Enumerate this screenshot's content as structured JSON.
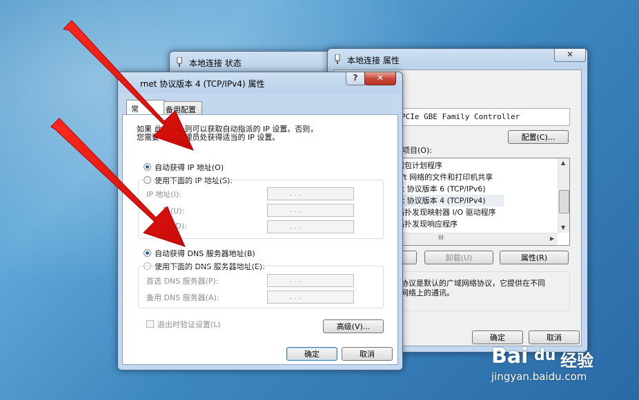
{
  "status_window": {
    "title": "本地连接 状态"
  },
  "properties_window": {
    "title": "本地连接 属性",
    "adapter_name": "PCIe GBE Family Controller",
    "configure_button": "配置(C)...",
    "items_label": "目项目(O):",
    "items": [
      "据包计划程序",
      "oft 网络的文件和打印机共享",
      "et 协议版本 6 (TCP/IPv6)",
      "et 协议版本 4 (TCP/IPv4)",
      "拓扑发现映射器 I/O 驱动程序",
      "拓扑发现响应程序"
    ],
    "hscroll_grip": "III",
    "uninstall_button": "卸载(U)",
    "properties_button": "属性(R)",
    "description": "协议是默认的广域网络协议，它提供在不同\n网络上的通讯。",
    "ok_button": "确定",
    "cancel_button": "取消"
  },
  "ipv4_dialog": {
    "title": "rnet 协议版本 4 (TCP/IPv4) 属性",
    "help_button": "?",
    "close_button": "✕",
    "tabs": {
      "general": "常",
      "alternate": "备用配置"
    },
    "intro_line1": "如果        此功能，则可以获取自动指派的 IP 设置。否则，",
    "intro_line2": "您需要          系统管理员处获得适当的 IP 设置。",
    "auto_ip": "自动获得 IP 地址(O)",
    "manual_ip": "使用下面的 IP 地址(S):",
    "ip_address_label": "IP 地址(I):",
    "subnet_label": "码(U):",
    "gateway_label": "(D):",
    "auto_dns": "自动获得 DNS 服务器地址(B)",
    "manual_dns": "使用下面的 DNS 服务器地址(E):",
    "preferred_dns_label": "首选 DNS 服务器(P):",
    "alternate_dns_label": "备用 DNS 服务器(A):",
    "validate_on_exit": "退出时验证设置(L)",
    "advanced_button": "高级(V)...",
    "ok_button": "确定",
    "cancel_button": "取消",
    "ip_dots": ".        .        ."
  },
  "watermark": {
    "brand": "Bai",
    "paw": "du",
    "jingyan": "经验",
    "url": "jingyan.baidu.com"
  },
  "colors": {
    "accent": "#1f5fa8",
    "arrow": "#e0120f"
  }
}
